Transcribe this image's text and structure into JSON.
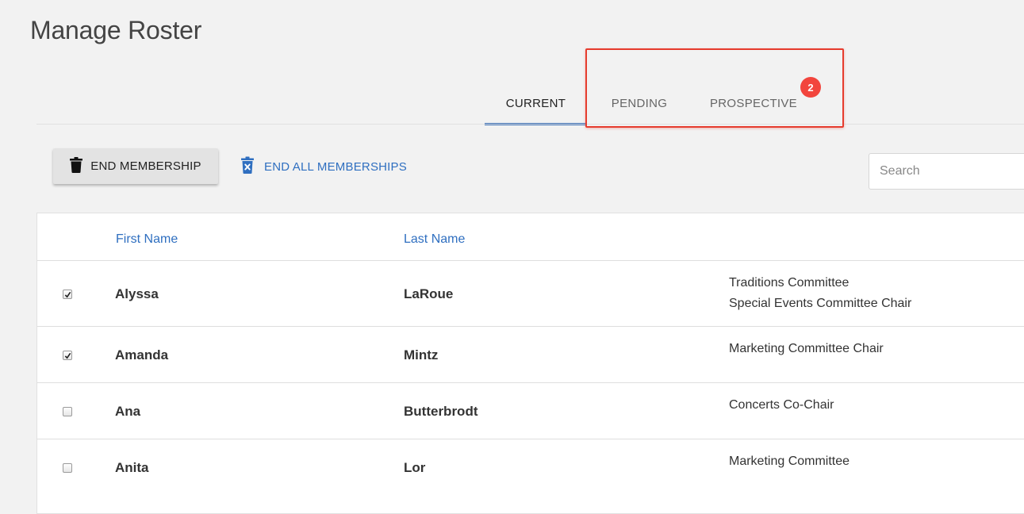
{
  "page": {
    "title": "Manage Roster"
  },
  "tabs": [
    {
      "label": "CURRENT",
      "active": true
    },
    {
      "label": "PENDING",
      "active": false
    },
    {
      "label": "PROSPECTIVE",
      "active": false,
      "badge": "2"
    }
  ],
  "toolbar": {
    "end_membership_label": "END MEMBERSHIP",
    "end_all_label": "END ALL MEMBERSHIPS",
    "search_placeholder": "Search"
  },
  "table": {
    "headers": {
      "first_name": "First Name",
      "last_name": "Last Name"
    },
    "rows": [
      {
        "checked": true,
        "first": "Alyssa",
        "last": "LaRoue",
        "roles": [
          "Traditions Committee",
          "Special Events Committee Chair"
        ]
      },
      {
        "checked": true,
        "first": "Amanda",
        "last": "Mintz",
        "roles": [
          "Marketing Committee Chair"
        ]
      },
      {
        "checked": false,
        "first": "Ana",
        "last": "Butterbrodt",
        "roles": [
          "Concerts Co-Chair"
        ]
      },
      {
        "checked": false,
        "first": "Anita",
        "last": "Lor",
        "roles": [
          "Marketing Committee"
        ]
      }
    ]
  },
  "colors": {
    "accent": "#3a6fb7",
    "link": "#2f6fc0",
    "badge": "#f2453d",
    "highlight": "#e63c2e"
  }
}
